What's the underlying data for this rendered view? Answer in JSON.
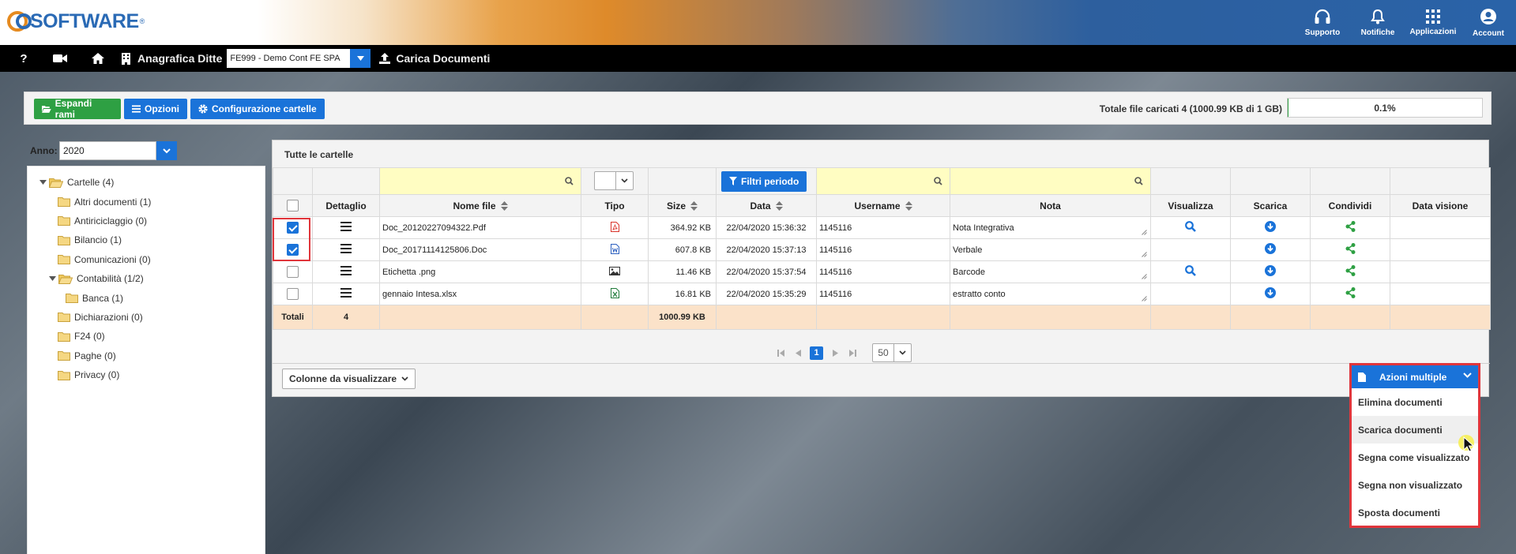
{
  "header": {
    "logo_text": "SOFTWARE",
    "logo_reg": "®",
    "actions": [
      {
        "label": "Supporto",
        "icon": "headset-icon"
      },
      {
        "label": "Notifiche",
        "icon": "bell-icon"
      },
      {
        "label": "Applicazioni",
        "icon": "grid-icon"
      },
      {
        "label": "Account",
        "icon": "user-circle-icon"
      }
    ]
  },
  "navbar": {
    "help": "?",
    "anagrafica_label": "Anagrafica Ditte",
    "ditta_value": "FE999 - Demo Cont FE SPA",
    "carica_label": "Carica Documenti"
  },
  "toolbar": {
    "espandi_label": "Espandi rami",
    "opzioni_label": "Opzioni",
    "config_label": "Configurazione cartelle",
    "total_label": "Totale file caricati 4 (1000.99 KB di 1 GB)",
    "progress_text": "0.1%",
    "progress_fraction": 0.001
  },
  "tree": {
    "anno_label": "Anno:",
    "anno_value": "2020",
    "items": [
      {
        "label": "Cartelle (4)",
        "expanded": true,
        "level": 0
      },
      {
        "label": "Altri documenti (1)",
        "level": 1
      },
      {
        "label": "Antiriciclaggio (0)",
        "level": 1
      },
      {
        "label": "Bilancio (1)",
        "level": 1
      },
      {
        "label": "Comunicazioni (0)",
        "level": 1
      },
      {
        "label": "Contabilità (1/2)",
        "expanded": true,
        "level": 1
      },
      {
        "label": "Banca (1)",
        "level": 2
      },
      {
        "label": "Dichiarazioni (0)",
        "level": 1
      },
      {
        "label": "F24 (0)",
        "level": 1
      },
      {
        "label": "Paghe (0)",
        "level": 1
      },
      {
        "label": "Privacy (0)",
        "level": 1
      }
    ]
  },
  "grid": {
    "title": "Tutte le cartelle",
    "filtri_label": "Filtri periodo",
    "columns": [
      "Dettaglio",
      "Nome file",
      "Tipo",
      "Size",
      "Data",
      "Username",
      "Nota",
      "Visualizza",
      "Scarica",
      "Condividi",
      "Data visione"
    ],
    "rows": [
      {
        "checked": true,
        "nome": "Doc_20120227094322.Pdf",
        "tipo": "pdf",
        "size": "364.92 KB",
        "data": "22/04/2020 15:36:32",
        "username": "1145116",
        "nota": "Nota Integrativa",
        "visualizza": true
      },
      {
        "checked": true,
        "nome": "Doc_20171114125806.Doc",
        "tipo": "word",
        "size": "607.8 KB",
        "data": "22/04/2020 15:37:13",
        "username": "1145116",
        "nota": "Verbale",
        "visualizza": false
      },
      {
        "checked": false,
        "nome": "Etichetta .png",
        "tipo": "image",
        "size": "11.46 KB",
        "data": "22/04/2020 15:37:54",
        "username": "1145116",
        "nota": "Barcode",
        "visualizza": true
      },
      {
        "checked": false,
        "nome": "gennaio Intesa.xlsx",
        "tipo": "excel",
        "size": "16.81 KB",
        "data": "22/04/2020 15:35:29",
        "username": "1145116",
        "nota": "estratto conto",
        "visualizza": false
      }
    ],
    "totals": {
      "label": "Totali",
      "count": "4",
      "size": "1000.99 KB"
    },
    "pager": {
      "current": "1",
      "page_size": "50"
    },
    "colonne_label": "Colonne da visualizzare"
  },
  "azioni": {
    "button_label": "Azioni multiple",
    "items": [
      "Elimina documenti",
      "Scarica documenti",
      "Segna come visualizzato",
      "Segna non visualizzato",
      "Sposta documenti"
    ],
    "hovered_index": 1
  },
  "colors": {
    "primary": "#1a73d9",
    "success": "#2ea043",
    "highlight_border": "#e0353b",
    "filter_bg": "#fffdc2",
    "totals_bg": "#fbe2c9"
  }
}
